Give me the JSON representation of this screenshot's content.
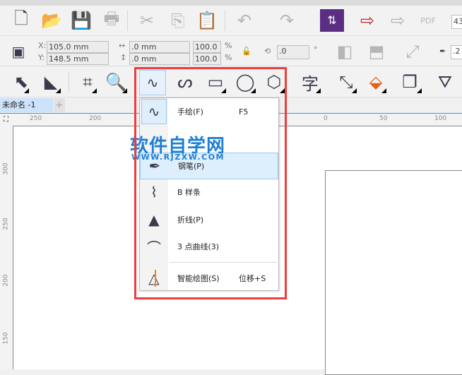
{
  "toolbar_standard": {
    "zoom_value": "43"
  },
  "property_bar": {
    "x_label": "X:",
    "x_value": "105.0 mm",
    "y_label": "Y:",
    "y_value": "148.5 mm",
    "width_value": ".0 mm",
    "height_value": ".0 mm",
    "scale_x": "100.0",
    "scale_y": "100.0",
    "percent": "%",
    "angle_value": ".0",
    "degree": "°",
    "outline_value": ".2"
  },
  "tools": {
    "text_tool_glyph": "字"
  },
  "document_tab": {
    "label": "未命名 -1",
    "add_label": "+"
  },
  "ruler": {
    "h_ticks": [
      "250",
      "200",
      "0",
      "50",
      "100"
    ],
    "v_ticks": [
      "300",
      "250",
      "200",
      "150"
    ]
  },
  "flyout_menu": {
    "items": [
      {
        "label": "手绘(F)",
        "shortcut": "F5",
        "icon": "freehand-icon"
      },
      {
        "label": "钢笔(P)",
        "shortcut": "",
        "icon": "pen-icon"
      },
      {
        "label": "B 样条",
        "shortcut": "",
        "icon": "b-spline-icon"
      },
      {
        "label": "折线(P)",
        "shortcut": "",
        "icon": "polyline-icon"
      },
      {
        "label": "3 点曲线(3)",
        "shortcut": "",
        "icon": "three-point-curve-icon"
      },
      {
        "label": "智能绘图(S)",
        "shortcut": "位移+S",
        "icon": "smart-drawing-icon"
      }
    ]
  },
  "watermark": {
    "title": "软件自学网",
    "url": "WWW.RJZXW.COM"
  },
  "colors": {
    "highlight": "#ddeefc",
    "annotation": "#f03c3c",
    "watermark": "#1f7fd4"
  }
}
